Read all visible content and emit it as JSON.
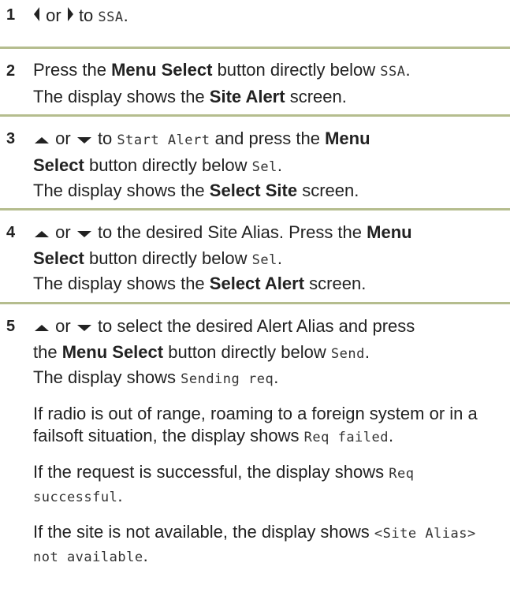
{
  "steps": [
    {
      "num": "1",
      "or": "or",
      "text": "to",
      "lcd": "SSA",
      "end": "."
    },
    {
      "num": "2",
      "pre": "Press the",
      "bold1": "Menu Select",
      "mid": "button directly below",
      "lcd": "SSA",
      "end": ".",
      "line2_pre": "The display shows the",
      "bold2": "Site Alert",
      "line2_post": "screen."
    },
    {
      "num": "3",
      "or": "or",
      "to": "to",
      "lcd1": "Start Alert",
      "and": "and press the",
      "bold1": "Menu",
      "bold1b": "Select",
      "below": "button directly below",
      "lcd2": "Sel",
      "end": ".",
      "line3_pre": "The display shows the",
      "bold2": "Select Site",
      "line3_post": "screen."
    },
    {
      "num": "4",
      "or": "or",
      "text1": "to the desired Site Alias. Press the",
      "bold1": "Menu",
      "bold1b": "Select",
      "below": "button directly below",
      "lcd": "Sel",
      "end": ".",
      "line3_pre": "The display shows the",
      "bold2": "Select Alert",
      "line3_post": "screen."
    },
    {
      "num": "5",
      "or": "or",
      "text1": "to select the desired Alert Alias and press",
      "the": "the",
      "bold1": "Menu Select",
      "below": "button directly below",
      "lcd1": "Send",
      "end": ".",
      "line3_pre": "The display shows",
      "lcd2": "Sending req",
      "end2": ".",
      "p1": "If radio is out of range, roaming to a foreign system or in a failsoft situation, the display shows",
      "p1_lcd": "Req failed",
      "p1_end": ".",
      "p2": "If the request is successful, the display shows",
      "p2_lcd": "Req successful",
      "p2_end": ".",
      "p3": "If the site is not available, the display shows",
      "p3_lcd": "<Site Alias> not available",
      "p3_end": "."
    }
  ],
  "colors": {
    "separator": "#b5bd8e",
    "text": "#222222"
  },
  "icons": [
    "left-arrow-icon",
    "right-arrow-icon",
    "up-arrow-icon",
    "down-arrow-icon"
  ]
}
